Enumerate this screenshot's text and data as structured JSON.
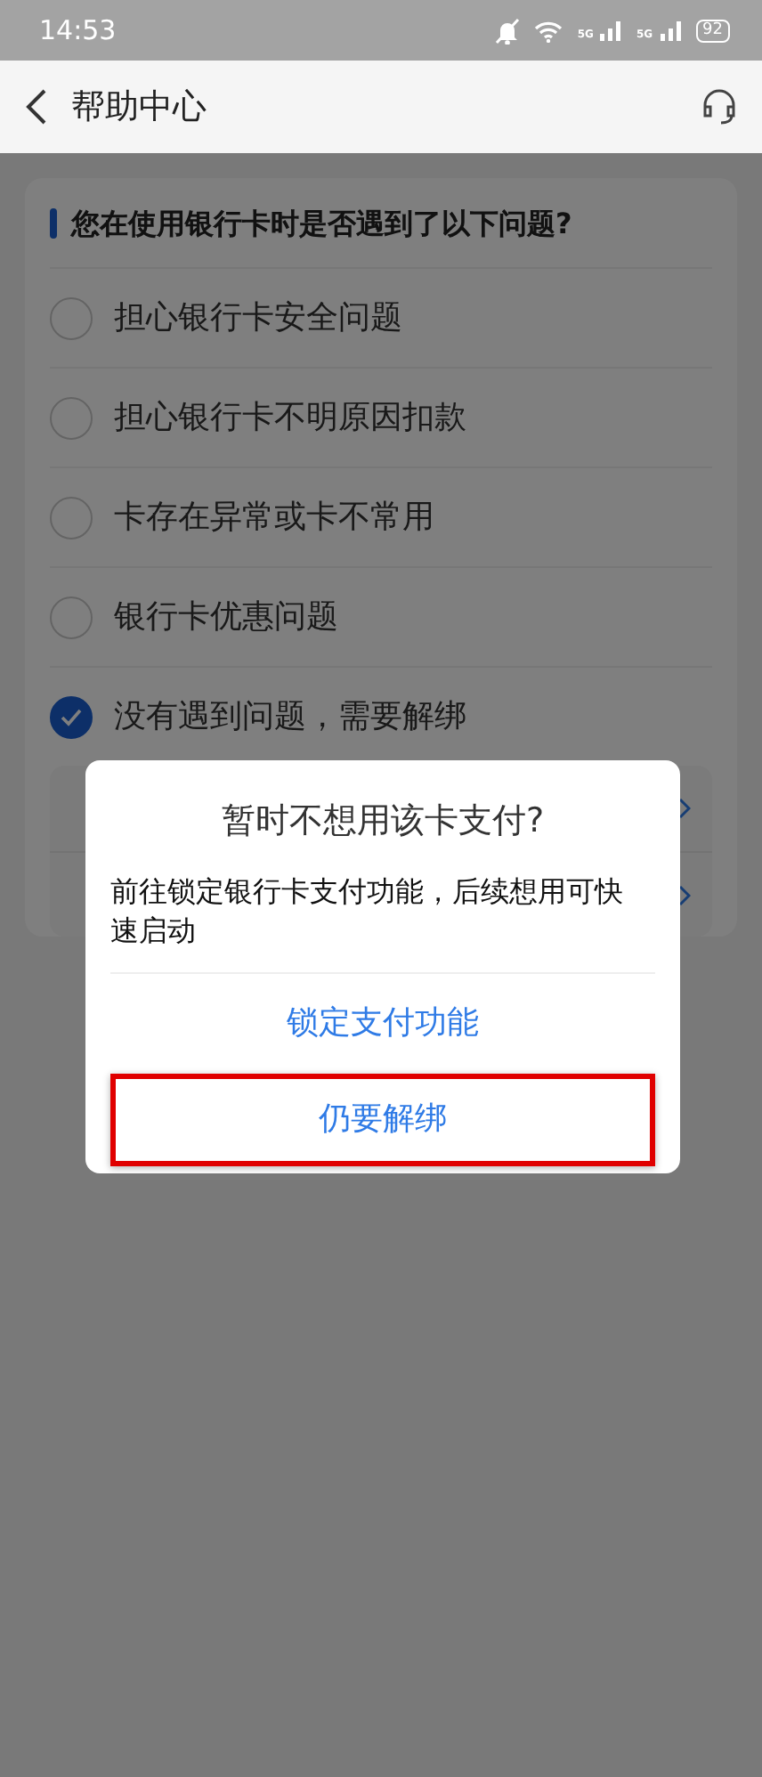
{
  "status_bar": {
    "time": "14:53",
    "network": [
      "5G",
      "5G"
    ],
    "battery": "92"
  },
  "header": {
    "title": "帮助中心"
  },
  "question": {
    "title": "您在使用银行卡时是否遇到了以下问题?",
    "options": [
      {
        "label": "担心银行卡安全问题",
        "selected": false
      },
      {
        "label": "担心银行卡不明原因扣款",
        "selected": false
      },
      {
        "label": "卡存在异常或卡不常用",
        "selected": false
      },
      {
        "label": "银行卡优惠问题",
        "selected": false
      },
      {
        "label": "没有遇到问题，需要解绑",
        "selected": true
      }
    ]
  },
  "dialog": {
    "title": "暂时不想用该卡支付?",
    "message": "前往锁定银行卡支付功能，后续想用可快速启动",
    "actions": [
      {
        "label": "锁定支付功能",
        "highlighted": false
      },
      {
        "label": "仍要解绑",
        "highlighted": true
      }
    ]
  }
}
